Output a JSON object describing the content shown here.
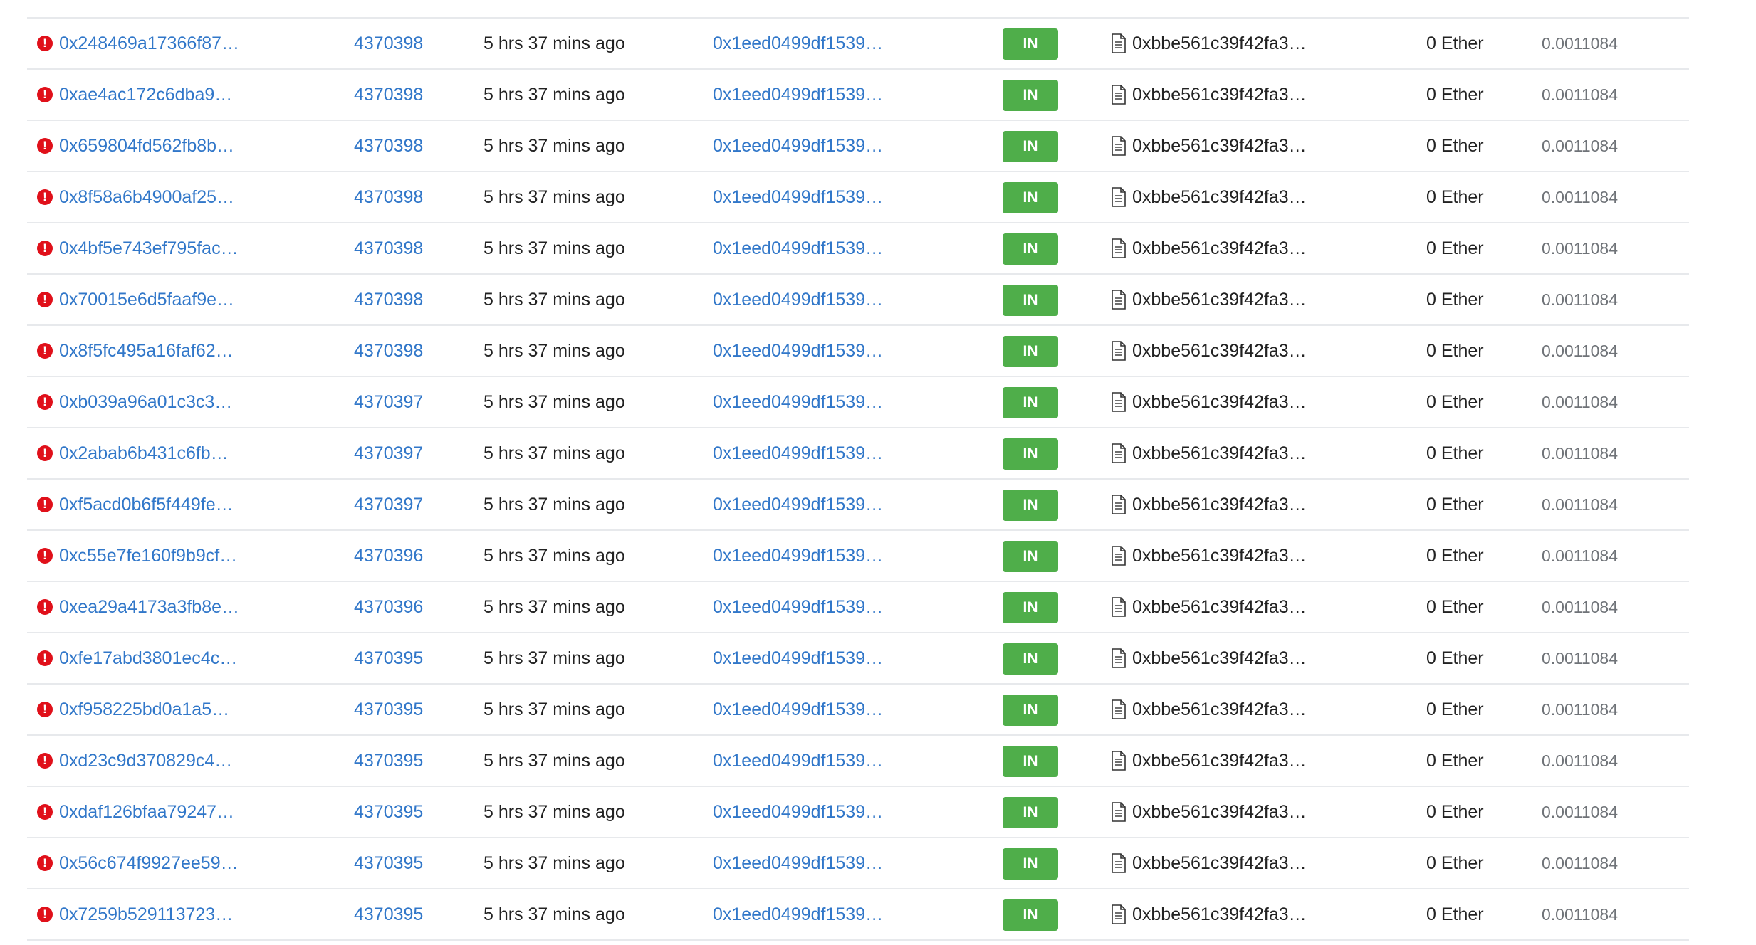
{
  "colors": {
    "link": "#3177c9",
    "error": "#e0101a",
    "badge_in": "#4fae4a",
    "fee_text": "#6f7378",
    "row_border": "#e7e9ec"
  },
  "icons": {
    "status": "exclamation-circle-icon",
    "contract": "contract-document-icon"
  },
  "transactions": [
    {
      "hash": "",
      "block": "",
      "age": "",
      "from": "",
      "direction": "",
      "to": "",
      "value": "",
      "fee": ""
    },
    {
      "hash": "0x248469a17366f87…",
      "block": "4370398",
      "age": "5 hrs 37 mins ago",
      "from": "0x1eed0499df1539…",
      "direction": "IN",
      "to": "0xbbe561c39f42fa3…",
      "value": "0 Ether",
      "fee": "0.0011084"
    },
    {
      "hash": "0xae4ac172c6dba9…",
      "block": "4370398",
      "age": "5 hrs 37 mins ago",
      "from": "0x1eed0499df1539…",
      "direction": "IN",
      "to": "0xbbe561c39f42fa3…",
      "value": "0 Ether",
      "fee": "0.0011084"
    },
    {
      "hash": "0x659804fd562fb8b…",
      "block": "4370398",
      "age": "5 hrs 37 mins ago",
      "from": "0x1eed0499df1539…",
      "direction": "IN",
      "to": "0xbbe561c39f42fa3…",
      "value": "0 Ether",
      "fee": "0.0011084"
    },
    {
      "hash": "0x8f58a6b4900af25…",
      "block": "4370398",
      "age": "5 hrs 37 mins ago",
      "from": "0x1eed0499df1539…",
      "direction": "IN",
      "to": "0xbbe561c39f42fa3…",
      "value": "0 Ether",
      "fee": "0.0011084"
    },
    {
      "hash": "0x4bf5e743ef795fac…",
      "block": "4370398",
      "age": "5 hrs 37 mins ago",
      "from": "0x1eed0499df1539…",
      "direction": "IN",
      "to": "0xbbe561c39f42fa3…",
      "value": "0 Ether",
      "fee": "0.0011084"
    },
    {
      "hash": "0x70015e6d5faaf9e…",
      "block": "4370398",
      "age": "5 hrs 37 mins ago",
      "from": "0x1eed0499df1539…",
      "direction": "IN",
      "to": "0xbbe561c39f42fa3…",
      "value": "0 Ether",
      "fee": "0.0011084"
    },
    {
      "hash": "0x8f5fc495a16faf62…",
      "block": "4370398",
      "age": "5 hrs 37 mins ago",
      "from": "0x1eed0499df1539…",
      "direction": "IN",
      "to": "0xbbe561c39f42fa3…",
      "value": "0 Ether",
      "fee": "0.0011084"
    },
    {
      "hash": "0xb039a96a01c3c3…",
      "block": "4370397",
      "age": "5 hrs 37 mins ago",
      "from": "0x1eed0499df1539…",
      "direction": "IN",
      "to": "0xbbe561c39f42fa3…",
      "value": "0 Ether",
      "fee": "0.0011084"
    },
    {
      "hash": "0x2abab6b431c6fb…",
      "block": "4370397",
      "age": "5 hrs 37 mins ago",
      "from": "0x1eed0499df1539…",
      "direction": "IN",
      "to": "0xbbe561c39f42fa3…",
      "value": "0 Ether",
      "fee": "0.0011084"
    },
    {
      "hash": "0xf5acd0b6f5f449fe…",
      "block": "4370397",
      "age": "5 hrs 37 mins ago",
      "from": "0x1eed0499df1539…",
      "direction": "IN",
      "to": "0xbbe561c39f42fa3…",
      "value": "0 Ether",
      "fee": "0.0011084"
    },
    {
      "hash": "0xc55e7fe160f9b9cf…",
      "block": "4370396",
      "age": "5 hrs 37 mins ago",
      "from": "0x1eed0499df1539…",
      "direction": "IN",
      "to": "0xbbe561c39f42fa3…",
      "value": "0 Ether",
      "fee": "0.0011084"
    },
    {
      "hash": "0xea29a4173a3fb8e…",
      "block": "4370396",
      "age": "5 hrs 37 mins ago",
      "from": "0x1eed0499df1539…",
      "direction": "IN",
      "to": "0xbbe561c39f42fa3…",
      "value": "0 Ether",
      "fee": "0.0011084"
    },
    {
      "hash": "0xfe17abd3801ec4c…",
      "block": "4370395",
      "age": "5 hrs 37 mins ago",
      "from": "0x1eed0499df1539…",
      "direction": "IN",
      "to": "0xbbe561c39f42fa3…",
      "value": "0 Ether",
      "fee": "0.0011084"
    },
    {
      "hash": "0xf958225bd0a1a5…",
      "block": "4370395",
      "age": "5 hrs 37 mins ago",
      "from": "0x1eed0499df1539…",
      "direction": "IN",
      "to": "0xbbe561c39f42fa3…",
      "value": "0 Ether",
      "fee": "0.0011084"
    },
    {
      "hash": "0xd23c9d370829c4…",
      "block": "4370395",
      "age": "5 hrs 37 mins ago",
      "from": "0x1eed0499df1539…",
      "direction": "IN",
      "to": "0xbbe561c39f42fa3…",
      "value": "0 Ether",
      "fee": "0.0011084"
    },
    {
      "hash": "0xdaf126bfaa79247…",
      "block": "4370395",
      "age": "5 hrs 37 mins ago",
      "from": "0x1eed0499df1539…",
      "direction": "IN",
      "to": "0xbbe561c39f42fa3…",
      "value": "0 Ether",
      "fee": "0.0011084"
    },
    {
      "hash": "0x56c674f9927ee59…",
      "block": "4370395",
      "age": "5 hrs 37 mins ago",
      "from": "0x1eed0499df1539…",
      "direction": "IN",
      "to": "0xbbe561c39f42fa3…",
      "value": "0 Ether",
      "fee": "0.0011084"
    },
    {
      "hash": "0x7259b529113723…",
      "block": "4370395",
      "age": "5 hrs 37 mins ago",
      "from": "0x1eed0499df1539…",
      "direction": "IN",
      "to": "0xbbe561c39f42fa3…",
      "value": "0 Ether",
      "fee": "0.0011084"
    }
  ]
}
